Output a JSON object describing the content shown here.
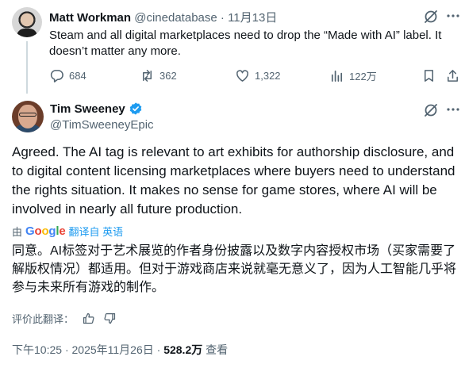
{
  "parent_tweet": {
    "name": "Matt Workman",
    "handle": "@cinedatabase",
    "separator": "·",
    "date": "11月13日",
    "text": "Steam and all digital marketplaces need to drop the “Made with AI” label. It doesn’t matter any more.",
    "replies": "684",
    "retweets": "362",
    "likes": "1,322",
    "views": "122万"
  },
  "main_tweet": {
    "name": "Tim Sweeney",
    "handle": "@TimSweeneyEpic",
    "verified": true,
    "text": "Agreed. The AI tag is relevant to art exhibits for authorship disclosure, and to digital content licensing marketplaces where buyers need to understand the rights situation. It makes no sense for game stores, where AI will be involved in nearly all future production.",
    "translation_by": "由",
    "translation_link": "翻译自 英语",
    "translated_text": "同意。AI标签对于艺术展览的作者身份披露以及数字内容授权市场（买家需要了解版权情况）都适用。但对于游戏商店来说就毫无意义了，因为人工智能几乎将参与未来所有游戏的制作。",
    "rate_translation": "评价此翻译：",
    "time": "下午10:25",
    "date": "2025年11月26日",
    "separator": "·",
    "views_count": "528.2万",
    "views_label": "查看"
  },
  "google_logo": [
    "G",
    "o",
    "o",
    "g",
    "l",
    "e"
  ],
  "colors": {
    "text": "#0f1419",
    "muted": "#536471",
    "link": "#1d9bf0",
    "verified": "#1d9bf0",
    "thread_line": "#cfd9de"
  }
}
